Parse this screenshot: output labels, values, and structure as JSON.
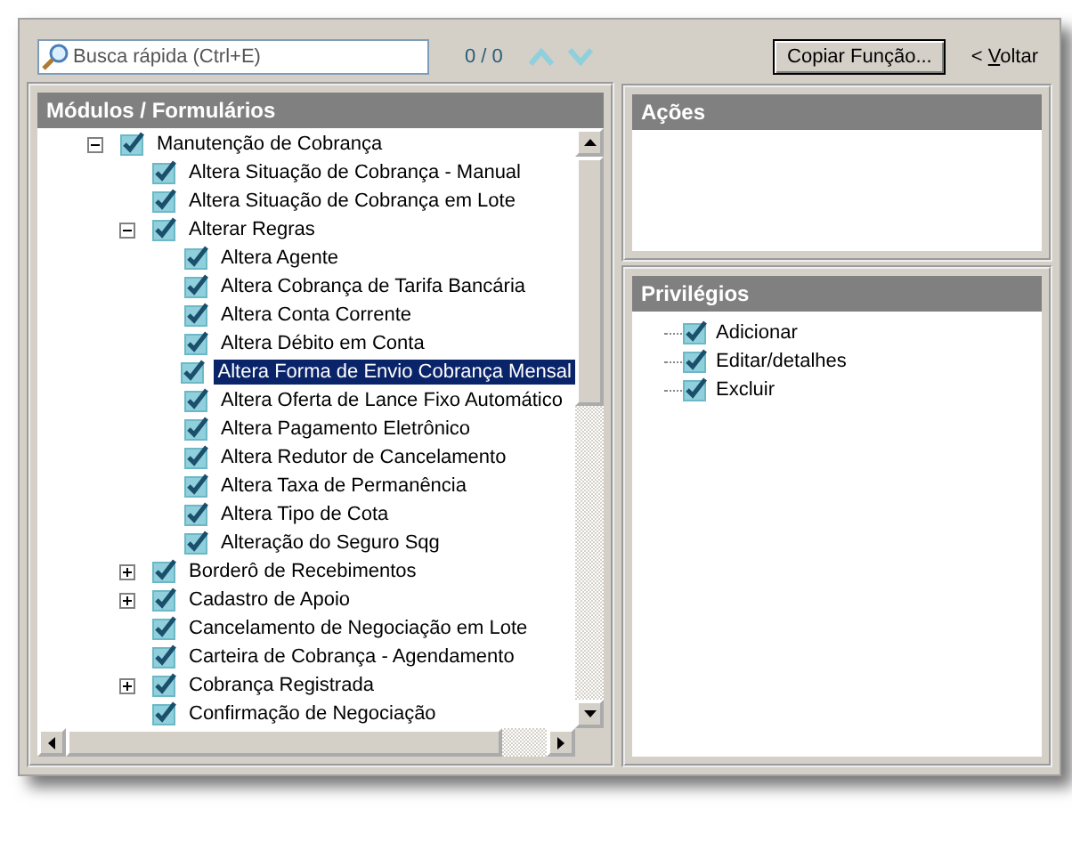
{
  "search": {
    "placeholder": "Busca rápida (Ctrl+E)",
    "counter": "0 / 0"
  },
  "copy_button": "Copiar Função...",
  "back_link": {
    "prefix": "< ",
    "accel": "V",
    "rest": "oltar"
  },
  "modules": {
    "title": "Módulos / Formulários",
    "tree": [
      {
        "label": "Manutenção de Cobrança",
        "checked": true,
        "expanded": true,
        "selected": false,
        "children": [
          {
            "label": "Altera Situação de Cobrança - Manual",
            "checked": true,
            "selected": false
          },
          {
            "label": "Altera Situação de Cobrança em Lote",
            "checked": true,
            "selected": false
          },
          {
            "label": "Alterar Regras",
            "checked": true,
            "expanded": true,
            "selected": false,
            "children": [
              {
                "label": "Altera Agente",
                "checked": true,
                "selected": false
              },
              {
                "label": "Altera Cobrança de Tarifa Bancária",
                "checked": true,
                "selected": false
              },
              {
                "label": "Altera Conta Corrente",
                "checked": true,
                "selected": false
              },
              {
                "label": "Altera Débito em Conta",
                "checked": true,
                "selected": false
              },
              {
                "label": "Altera Forma de Envio Cobrança Mensal",
                "checked": true,
                "selected": true
              },
              {
                "label": "Altera Oferta de Lance Fixo Automático",
                "checked": true,
                "selected": false
              },
              {
                "label": "Altera Pagamento Eletrônico",
                "checked": true,
                "selected": false
              },
              {
                "label": "Altera Redutor de Cancelamento",
                "checked": true,
                "selected": false
              },
              {
                "label": "Altera Taxa de Permanência",
                "checked": true,
                "selected": false
              },
              {
                "label": "Altera Tipo de Cota",
                "checked": true,
                "selected": false
              },
              {
                "label": "Alteração do Seguro Sqg",
                "checked": true,
                "selected": false
              }
            ]
          },
          {
            "label": "Borderô de Recebimentos",
            "checked": true,
            "expanded": false,
            "selected": false
          },
          {
            "label": "Cadastro de Apoio",
            "checked": true,
            "expanded": false,
            "selected": false
          },
          {
            "label": "Cancelamento de Negociação em Lote",
            "checked": true,
            "selected": false
          },
          {
            "label": "Carteira de Cobrança - Agendamento",
            "checked": true,
            "selected": false
          },
          {
            "label": "Cobrança Registrada",
            "checked": true,
            "expanded": false,
            "selected": false
          },
          {
            "label": "Confirmação de Negociação",
            "checked": true,
            "selected": false
          }
        ]
      }
    ]
  },
  "actions": {
    "title": "Ações"
  },
  "privileges": {
    "title": "Privilégios",
    "items": [
      {
        "label": "Adicionar",
        "checked": true
      },
      {
        "label": "Editar/detalhes",
        "checked": true
      },
      {
        "label": "Excluir",
        "checked": true
      }
    ]
  }
}
